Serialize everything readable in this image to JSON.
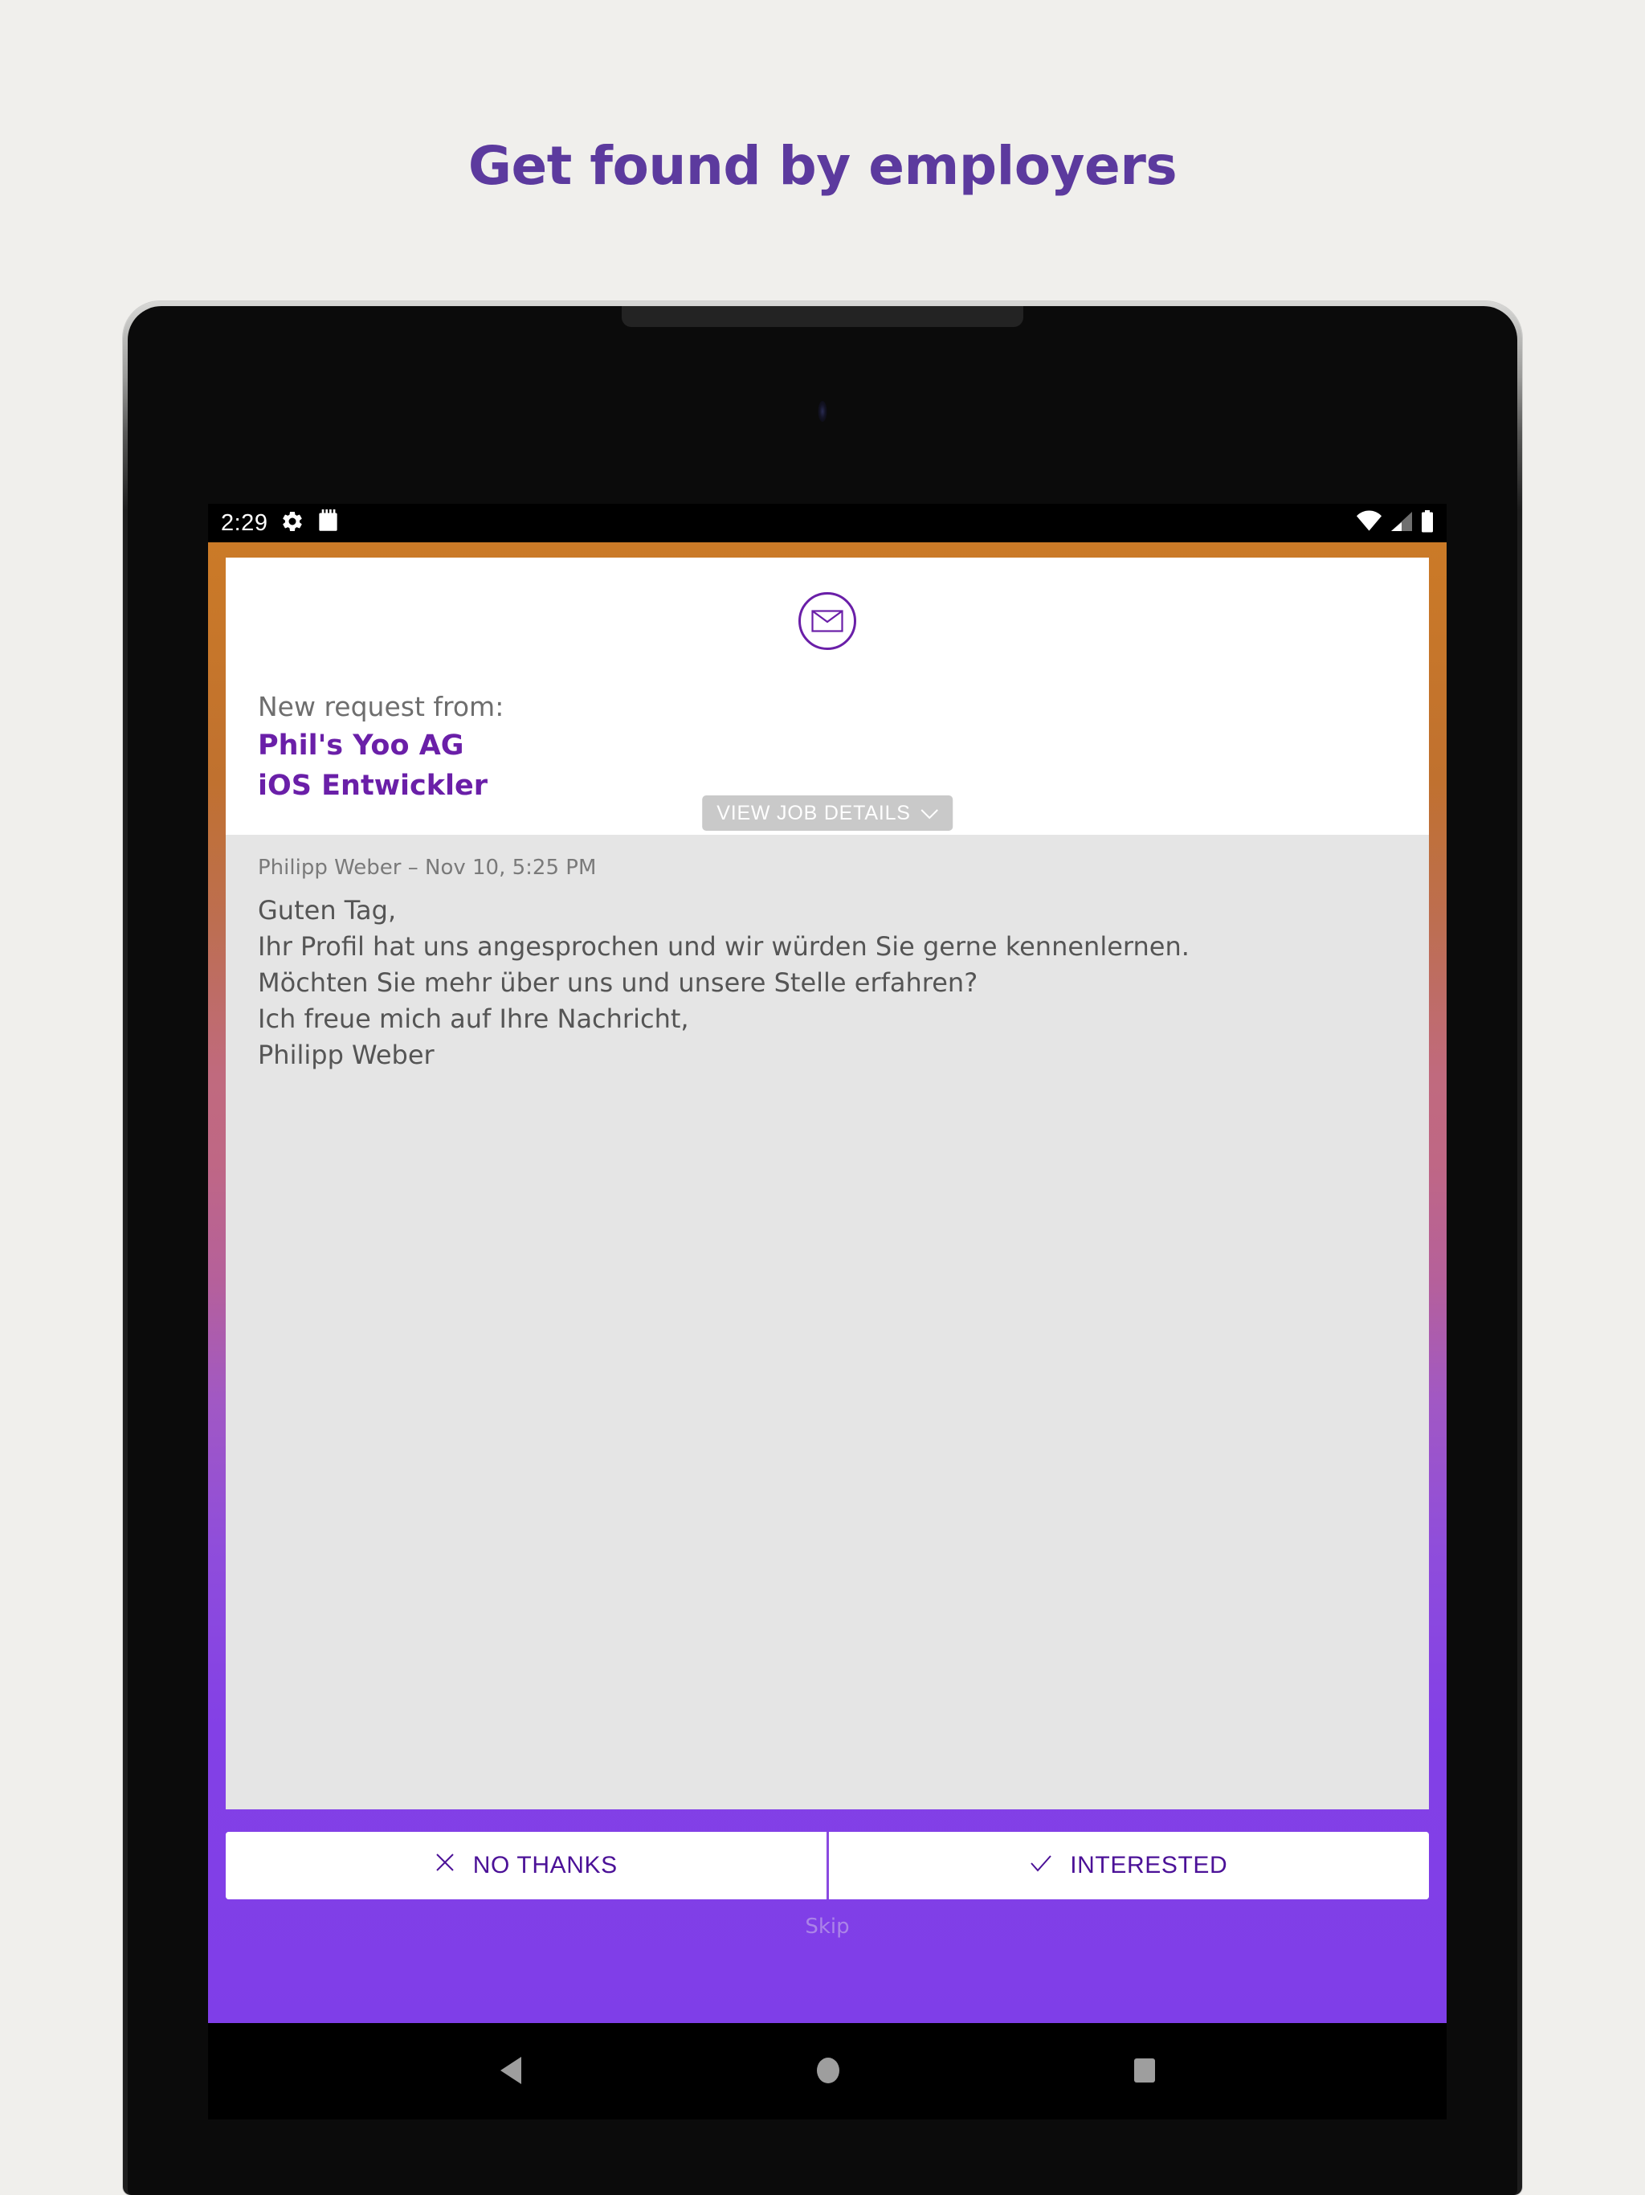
{
  "promo": {
    "heading": "Get found by employers",
    "heading_color": "#5c3a9e",
    "page_background": "#f0efec"
  },
  "device": {
    "type": "android-tablet",
    "speaker_icon": "speaker-notch",
    "camera_icon": "front-camera"
  },
  "status_bar": {
    "clock": "2:29",
    "left_icons": [
      "gear-icon",
      "calendar-icon"
    ],
    "right_icons": [
      "wifi-icon",
      "cell-signal-icon",
      "battery-icon"
    ],
    "background": "#000000"
  },
  "app": {
    "gradient_top": "#cb7a27",
    "gradient_mid": "#bf6785",
    "gradient_bottom": "#7f3ee8",
    "accent_purple": "#6a1fa8"
  },
  "header": {
    "envelope_icon": "envelope-icon",
    "request_label": "New request from:",
    "company": "Phil's Yoo AG",
    "role": "iOS Entwickler",
    "view_job_label": "VIEW JOB DETAILS",
    "view_job_chevron": "chevron-down-icon",
    "view_job_background": "#c9c9c9"
  },
  "message": {
    "meta": "Philipp Weber – Nov 10, 5:25 PM",
    "sender": "Philipp Weber",
    "date": "Nov 10, 5:25 PM",
    "body": "Guten Tag,\nIhr Profil hat uns angesprochen und wir würden Sie gerne kennenlernen.\nMöchten Sie mehr über uns und unsere Stelle erfahren?\nIch freue mich auf Ihre Nachricht,\nPhilipp Weber",
    "background": "#e5e5e5"
  },
  "actions": {
    "decline_label": "NO THANKS",
    "decline_icon": "close-x-icon",
    "accept_label": "INTERESTED",
    "accept_icon": "check-icon",
    "skip_label": "Skip"
  },
  "nav_bar": {
    "back_icon": "back-triangle-icon",
    "home_icon": "home-circle-icon",
    "recents_icon": "recents-square-icon"
  }
}
